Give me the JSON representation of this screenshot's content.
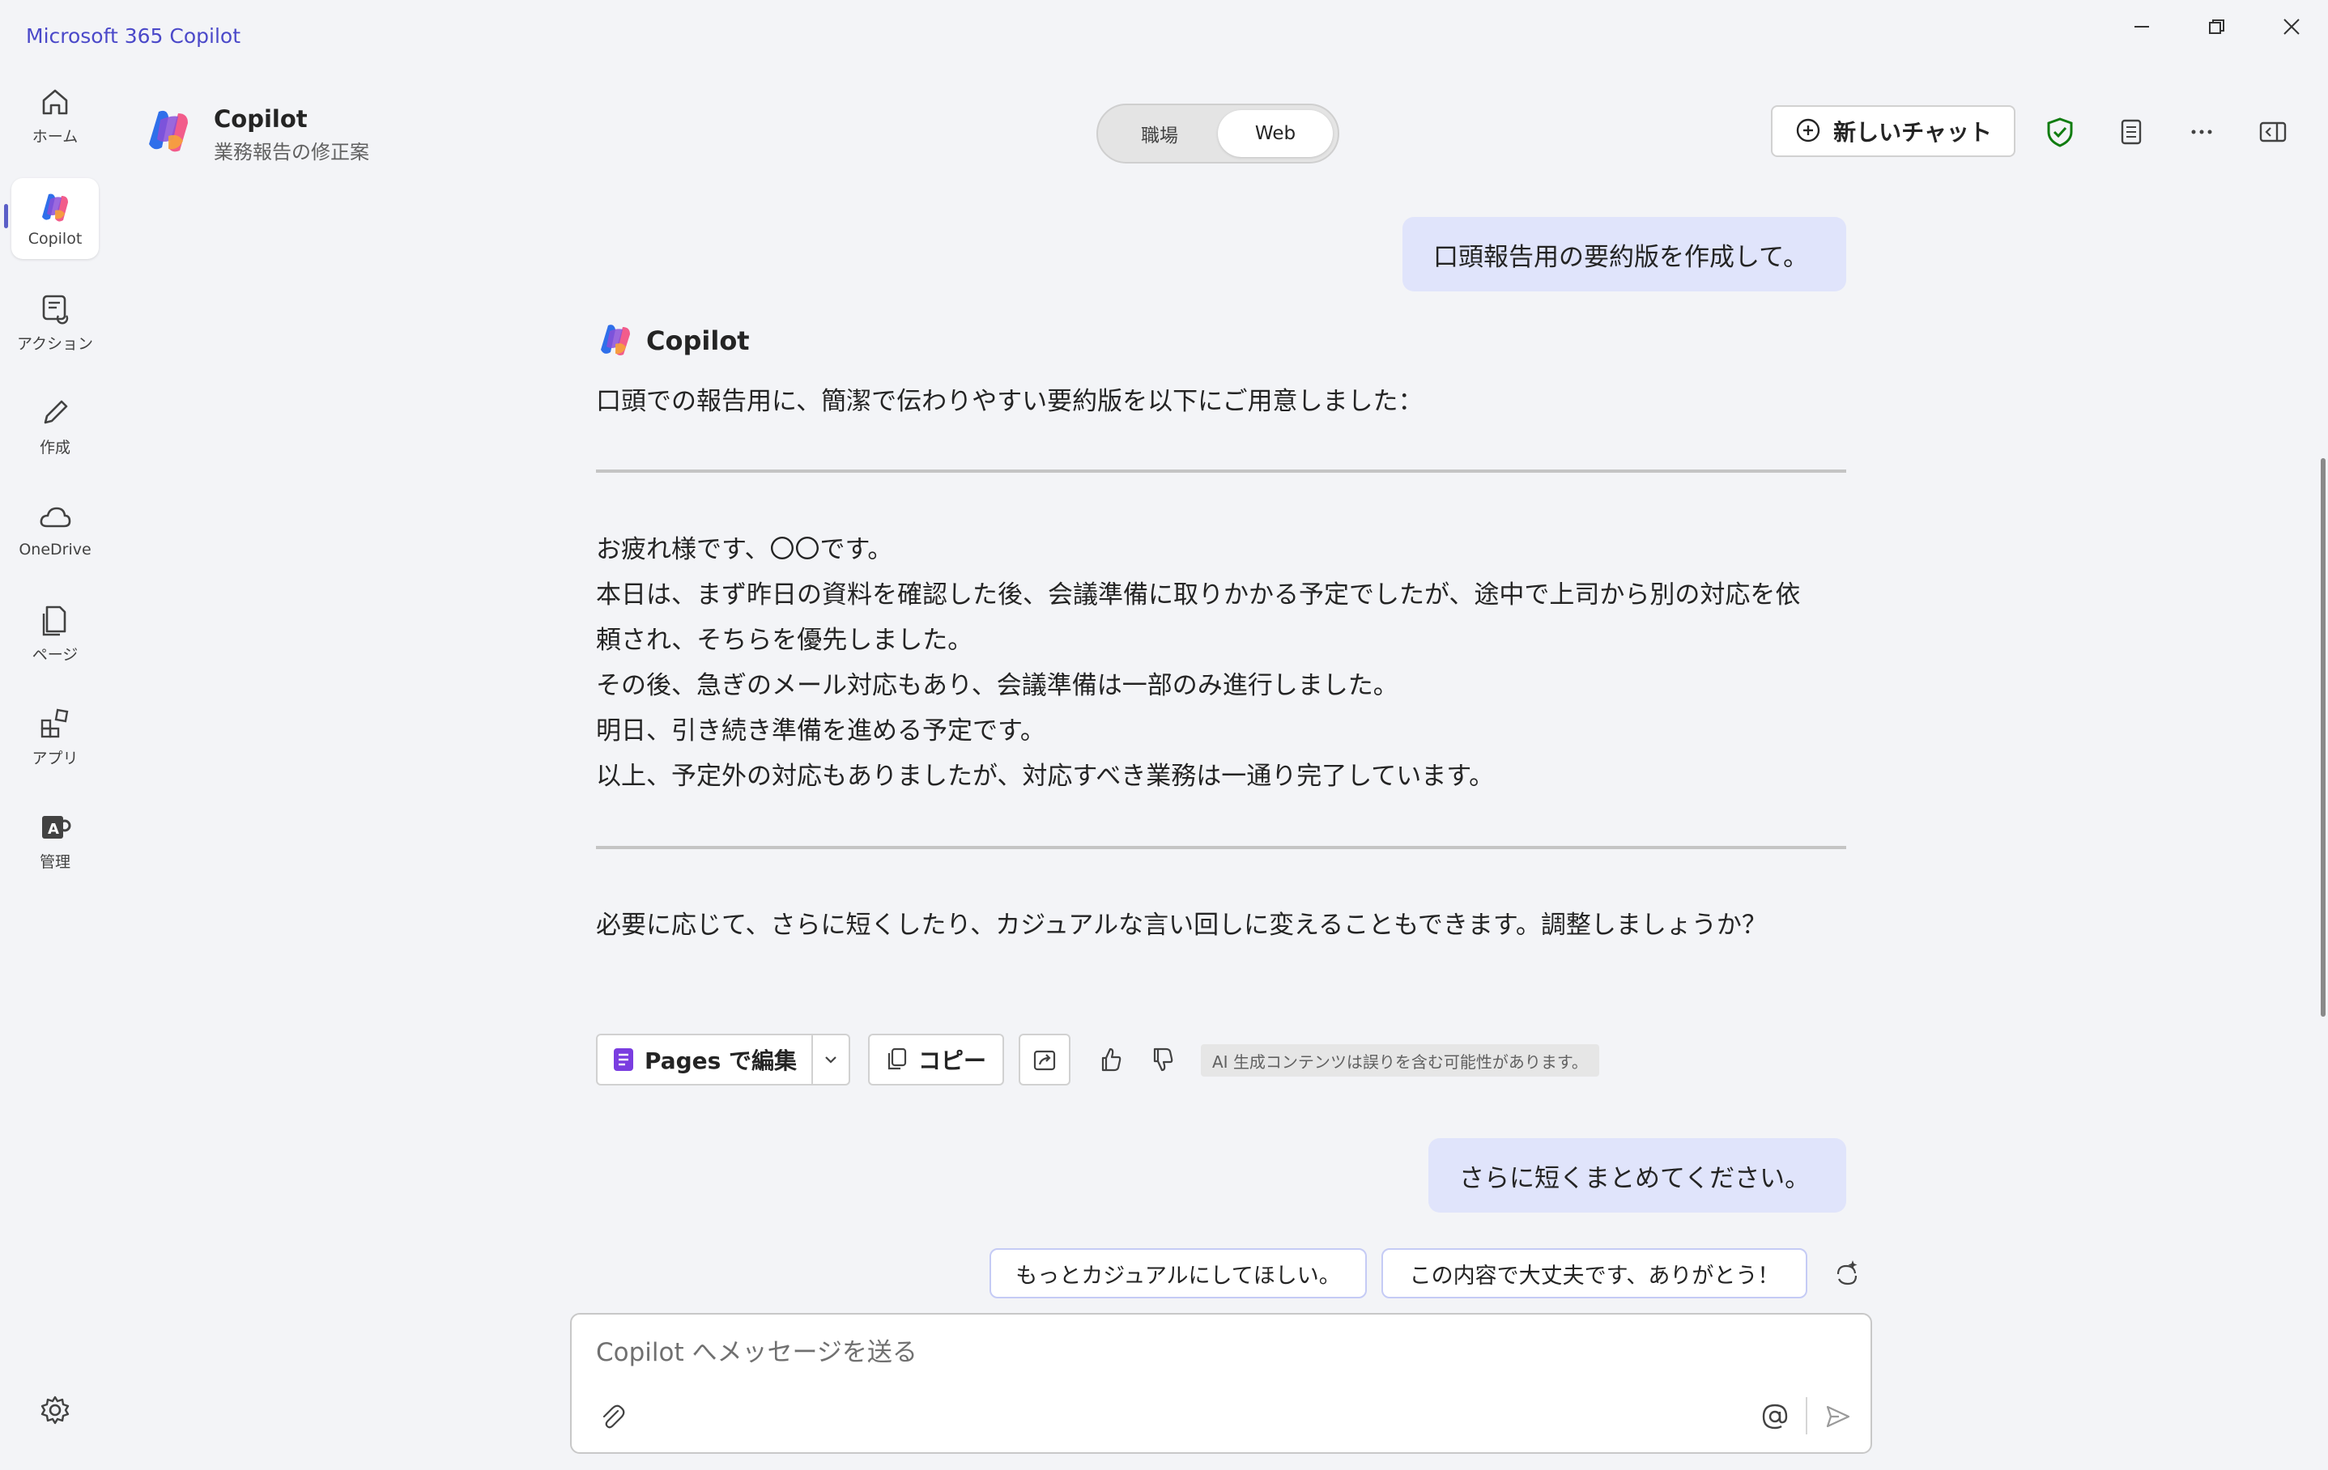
{
  "app": {
    "title": "Microsoft 365 Copilot"
  },
  "window_controls": {
    "minimize_icon": "minimize-icon",
    "restore_icon": "restore-icon",
    "close_icon": "close-icon"
  },
  "sidebar": {
    "items": [
      {
        "label": "ホーム",
        "icon": "home-icon"
      },
      {
        "label": "Copilot",
        "icon": "copilot-icon",
        "active": true
      },
      {
        "label": "アクション",
        "icon": "actions-icon"
      },
      {
        "label": "作成",
        "icon": "pen-icon"
      },
      {
        "label": "OneDrive",
        "icon": "cloud-icon"
      },
      {
        "label": "ページ",
        "icon": "pages-icon"
      },
      {
        "label": "アプリ",
        "icon": "apps-icon"
      },
      {
        "label": "管理",
        "icon": "admin-icon"
      }
    ],
    "settings_icon": "gear-icon"
  },
  "header": {
    "title": "Copilot",
    "subtitle": "業務報告の修正案",
    "toggle": {
      "work": "職場",
      "web": "Web",
      "selected": "Web"
    },
    "new_chat": "新しいチャット",
    "accent": "#5b5fc7",
    "shield_color": "#107c10"
  },
  "chat": {
    "user_message_1": "口頭報告用の要約版を作成して。",
    "copilot_name": "Copilot",
    "intro": "口頭での報告用に、簡潔で伝わりやすい要約版を以下にご用意しました：",
    "summary_lines": [
      "お疲れ様です、〇〇です。",
      "本日は、まず昨日の資料を確認した後、会議準備に取りかかる予定でしたが、途中で上司から別の対応を依",
      "頼され、そちらを優先しました。",
      "その後、急ぎのメール対応もあり、会議準備は一部のみ進行しました。",
      "明日、引き続き準備を進める予定です。",
      "以上、予定外の対応もありましたが、対応すべき業務は一通り完了しています。"
    ],
    "followup": "必要に応じて、さらに短くしたり、カジュアルな言い回しに変えることもできます。調整しましょうか？",
    "actions": {
      "edit_in_pages": "Pages で編集",
      "copy": "コピー",
      "disclaimer": "AI 生成コンテンツは誤りを含む可能性があります。"
    },
    "user_message_2": "さらに短くまとめてください。",
    "suggestions": [
      "もっとカジュアルにしてほしい。",
      "この内容で大丈夫です、ありがとう！"
    ]
  },
  "composer": {
    "placeholder": "Copilot へメッセージを送る"
  }
}
